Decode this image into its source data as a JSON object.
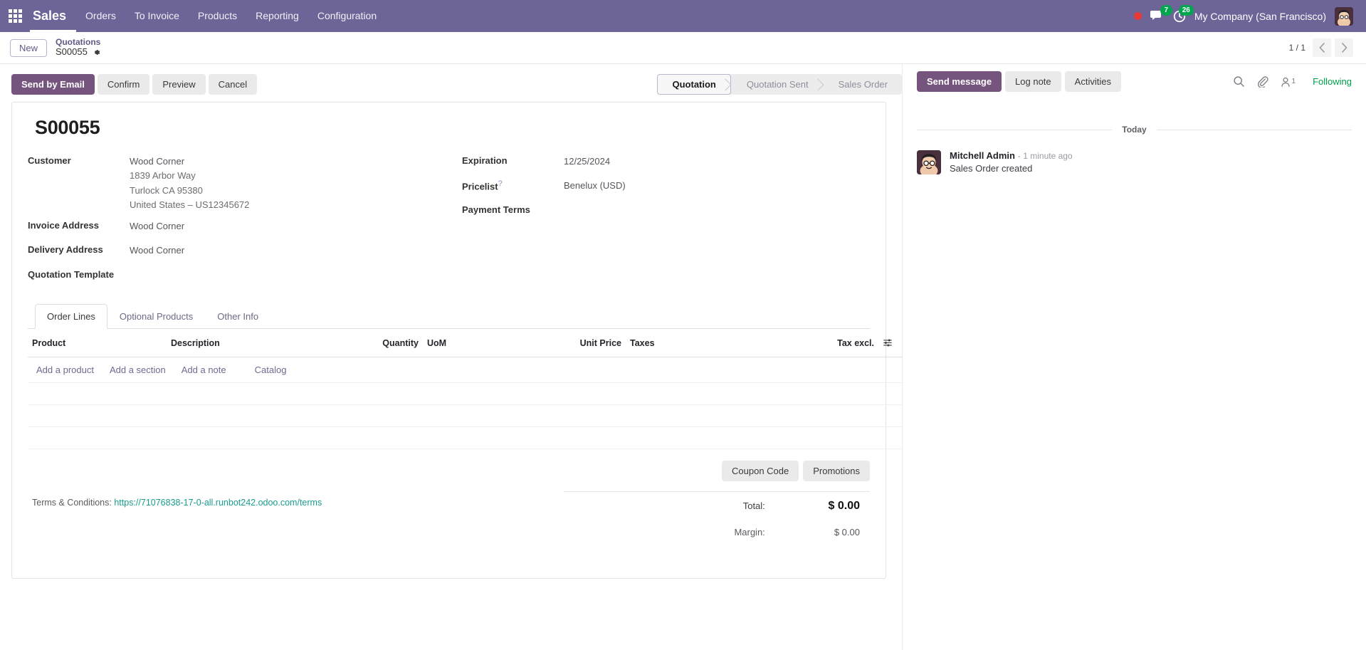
{
  "navbar": {
    "apps_icon": "grid-apps-icon",
    "brand": "Sales",
    "menu": [
      "Orders",
      "To Invoice",
      "Products",
      "Reporting",
      "Configuration"
    ],
    "recording_dot": "record-dot-icon",
    "messages_icon": "chat-bubble-icon",
    "messages_count": "7",
    "activities_icon": "clock-activity-icon",
    "activities_count": "26",
    "company": "My Company (San Francisco)",
    "avatar": "user-avatar",
    "accent": "#6d6498",
    "badge_color": "#00a64d"
  },
  "control_panel": {
    "new_label": "New",
    "breadcrumb_parent": "Quotations",
    "breadcrumb_current": "S00055",
    "gear_icon": "gear-icon",
    "pager_text": "1 / 1",
    "prev_icon": "chevron-left-icon",
    "next_icon": "chevron-right-icon"
  },
  "actions": {
    "send_by_email": "Send by Email",
    "confirm": "Confirm",
    "preview": "Preview",
    "cancel": "Cancel"
  },
  "statusbar": {
    "steps": [
      "Quotation",
      "Quotation Sent",
      "Sales Order"
    ],
    "active": "Quotation"
  },
  "form": {
    "title": "S00055",
    "left": [
      {
        "label": "Customer",
        "value": "Wood Corner",
        "address": [
          "1839 Arbor Way",
          "Turlock CA 95380",
          "United States – US12345672"
        ]
      },
      {
        "label": "Invoice Address",
        "value": "Wood Corner"
      },
      {
        "label": "Delivery Address",
        "value": "Wood Corner"
      },
      {
        "label": "Quotation Template",
        "value": ""
      }
    ],
    "right": [
      {
        "label": "Expiration",
        "value": "12/25/2024"
      },
      {
        "label": "Pricelist",
        "help": "?",
        "value": "Benelux (USD)"
      },
      {
        "label": "Payment Terms",
        "value": ""
      }
    ]
  },
  "notebook": {
    "tabs": [
      "Order Lines",
      "Optional Products",
      "Other Info"
    ],
    "active_tab": "Order Lines"
  },
  "lines_table": {
    "columns": [
      "Product",
      "Description",
      "Quantity",
      "UoM",
      "Unit Price",
      "Taxes",
      "Tax excl."
    ],
    "options_icon": "table-options-icon",
    "rows": [],
    "empty_rows": 3,
    "add_links": [
      "Add a product",
      "Add a section",
      "Add a note",
      "Catalog"
    ]
  },
  "promotions": {
    "coupon_code": "Coupon Code",
    "promotions": "Promotions"
  },
  "terms": {
    "label": "Terms & Conditions:",
    "url": "https://71076838-17-0-all.runbot242.odoo.com/terms",
    "link_color": "#1a9c8d"
  },
  "totals": [
    {
      "label": "Total:",
      "value": "$ 0.00",
      "emphasis": true
    },
    {
      "label": "Margin:",
      "value": "$ 0.00",
      "emphasis": false
    }
  ],
  "chatter": {
    "send_message": "Send message",
    "log_note": "Log note",
    "activities": "Activities",
    "search_icon": "search-icon",
    "attachment_icon": "paperclip-icon",
    "followers_icon": "followers-icon",
    "followers_count": "1",
    "following_label": "Following",
    "following_color": "#00a04a",
    "day_divider": "Today",
    "messages": [
      {
        "author": "Mitchell Admin",
        "time": "1 minute ago",
        "separator": "-",
        "body": "Sales Order created"
      }
    ]
  }
}
